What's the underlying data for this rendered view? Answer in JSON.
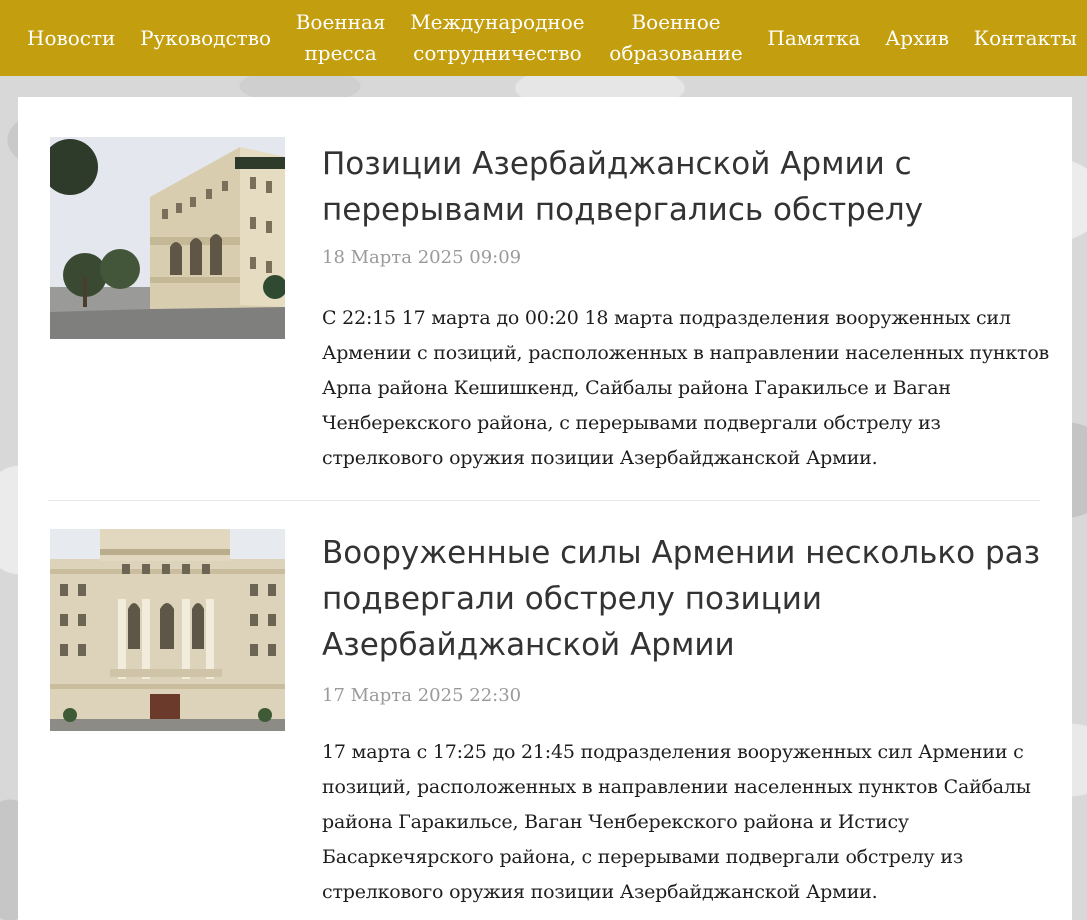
{
  "nav": {
    "items": [
      {
        "label": "Новости"
      },
      {
        "label": "Руководство"
      },
      {
        "label": "Военная\nпресса"
      },
      {
        "label": "Международное\nсотрудничество"
      },
      {
        "label": "Военное\nобразование"
      },
      {
        "label": "Памятка"
      },
      {
        "label": "Архив"
      },
      {
        "label": "Контакты"
      }
    ]
  },
  "colors": {
    "nav_background": "#c39f0f",
    "title_text": "#333333",
    "date_text": "#9a9a9a"
  },
  "articles": [
    {
      "image_icon": "ministry-building-angled-photo",
      "title": "Позиции Азербайджанской Армии с перерывами подвергались обстрелу",
      "date": "18 Марта 2025 09:09",
      "excerpt": "С 22:15 17 марта до 00:20 18 марта подразделения вооруженных сил Армении с позиций, расположенных в направлении населенных пунктов Арпа района Кешишкенд, Сайбалы района Гаракильсе и Ваган Ченберекского района, с перерывами подвергали обстрелу из стрелкового оружия позиции Азербайджанской Армии."
    },
    {
      "image_icon": "ministry-building-front-photo",
      "title": "Вооруженные силы Армении несколько раз подвергали обстрелу позиции Азербайджанской Армии",
      "date": "17 Марта 2025 22:30",
      "excerpt": "17 марта с 17:25 до 21:45 подразделения вооруженных сил Армении с позиций, расположенных в направлении населенных пунктов Сайбалы района Гаракильсе, Ваган Ченберекского района и Иcтису Басаркечярского района, с перерывами подвергали обстрелу из стрелкового оружия позиции Азербайджанской Армии."
    }
  ]
}
